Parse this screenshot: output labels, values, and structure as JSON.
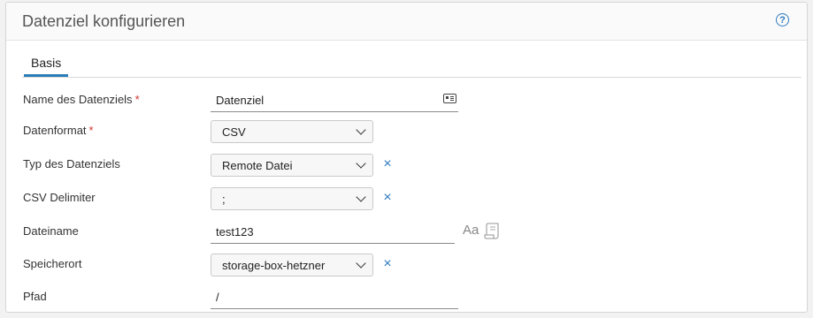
{
  "header": {
    "title": "Datenziel konfigurieren",
    "help_icon": "question-circle-icon"
  },
  "tabs": [
    {
      "label": "Basis",
      "active": true
    }
  ],
  "form": {
    "name": {
      "label": "Name des Datenziels",
      "required": true,
      "value": "Datenziel",
      "icon": "id-card-icon"
    },
    "format": {
      "label": "Datenformat",
      "required": true,
      "value": "CSV"
    },
    "type": {
      "label": "Typ des Datenziels",
      "value": "Remote Datei",
      "clearable": true
    },
    "delimiter": {
      "label": "CSV Delimiter",
      "value": ";",
      "clearable": true
    },
    "filename": {
      "label": "Dateiname",
      "value": "test123",
      "icons": [
        "text-format-icon",
        "script-icon"
      ]
    },
    "storage": {
      "label": "Speicherort",
      "value": "storage-box-hetzner",
      "clearable": true
    },
    "path": {
      "label": "Pfad",
      "value": "/"
    }
  },
  "colors": {
    "accent": "#2e7bbf",
    "required": "#d0312d"
  },
  "required_mark": "*",
  "clear_glyph": "×",
  "aa_glyph": "Aa",
  "help_glyph": "?"
}
